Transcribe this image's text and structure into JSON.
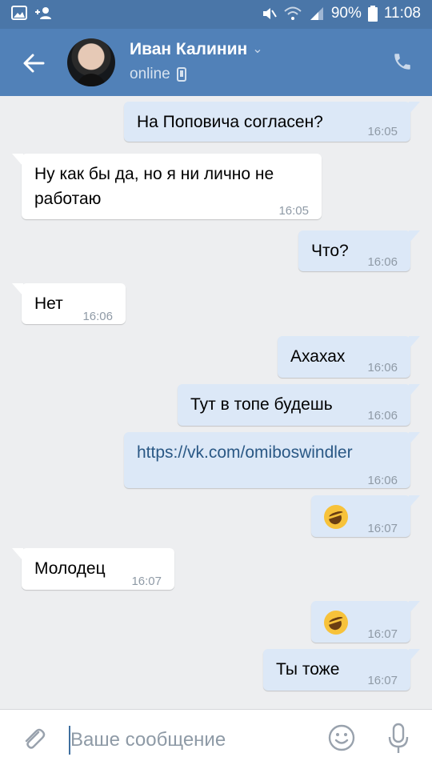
{
  "status_bar": {
    "battery": "90%",
    "time": "11:08"
  },
  "header": {
    "name": "Иван Калинин",
    "status": "online"
  },
  "messages": [
    {
      "dir": "out",
      "text": "На Поповича согласен?",
      "time": "16:05"
    },
    {
      "dir": "in",
      "text1": "Ну как бы да, но я ни лично не",
      "text2": "работаю",
      "time": "16:05"
    },
    {
      "dir": "out",
      "text": "Что?",
      "time": "16:06"
    },
    {
      "dir": "in",
      "text": "Нет",
      "time": "16:06"
    },
    {
      "dir": "out",
      "text": "Ахахах",
      "time": "16:06"
    },
    {
      "dir": "out",
      "text": "Тут в топе будешь",
      "time": "16:06"
    },
    {
      "dir": "out",
      "text": "https://vk.com/omiboswindler",
      "time": "16:06"
    },
    {
      "dir": "out",
      "emoji": "rolling-on-floor-laughing",
      "time": "16:07"
    },
    {
      "dir": "in",
      "text": "Молодец",
      "time": "16:07"
    },
    {
      "dir": "out",
      "emoji": "rolling-on-floor-laughing",
      "time": "16:07"
    },
    {
      "dir": "out",
      "text": "Ты тоже",
      "time": "16:07"
    }
  ],
  "composer": {
    "placeholder": "Ваше сообщение"
  },
  "colors": {
    "header": "#5181b8",
    "status_bar": "#4a76a8",
    "outgoing_bubble": "#dce8f7",
    "incoming_bubble": "#ffffff",
    "background": "#edeef0"
  }
}
